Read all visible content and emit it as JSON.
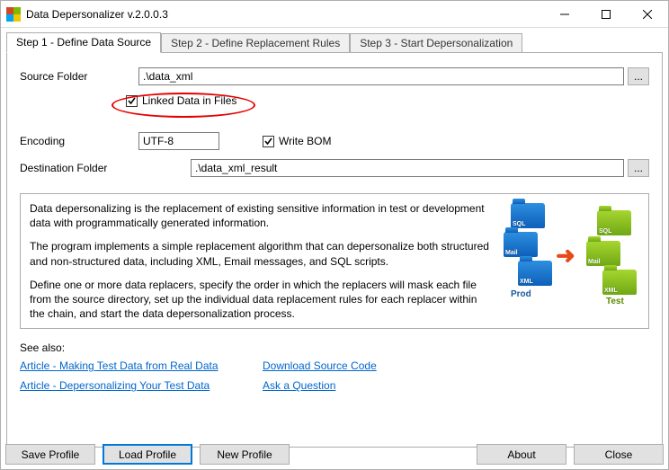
{
  "window": {
    "title": "Data Depersonalizer v.2.0.0.3"
  },
  "tabs": [
    {
      "label": "Step 1 - Define Data Source"
    },
    {
      "label": "Step 2 - Define Replacement Rules"
    },
    {
      "label": "Step 3 - Start Depersonalization"
    }
  ],
  "step1": {
    "sourceFolderLabel": "Source Folder",
    "sourceFolderValue": ".\\data_xml",
    "linkedDataLabel": "Linked Data in Files",
    "encodingLabel": "Encoding",
    "encodingValue": "UTF-8",
    "writeBomLabel": "Write BOM",
    "destFolderLabel": "Destination Folder",
    "destFolderValue": ".\\data_xml_result"
  },
  "description": {
    "p1": "Data depersonalizing is the replacement of existing sensitive information in test or development data with programmatically generated information.",
    "p2": "The program implements a simple replacement algorithm that can depersonalize both structured and non-structured data, including XML, Email messages, and SQL scripts.",
    "p3": "Define one or more data replacers, specify the order in which the replacers will mask each file from the source directory, set up the individual data replacement rules for each replacer within the chain, and start the data depersonalization process."
  },
  "diagram": {
    "prod": "Prod",
    "test": "Test",
    "sql": "SQL",
    "mail": "Mail",
    "xml": "XML"
  },
  "links": {
    "seeAlso": "See also:",
    "a1": "Article - Making Test Data from Real Data",
    "a2": "Article - Depersonalizing Your Test Data",
    "a3": "Download Source Code",
    "a4": "Ask a Question"
  },
  "buttons": {
    "save": "Save Profile",
    "load": "Load Profile",
    "newp": "New Profile",
    "about": "About",
    "close": "Close",
    "browse": "..."
  }
}
